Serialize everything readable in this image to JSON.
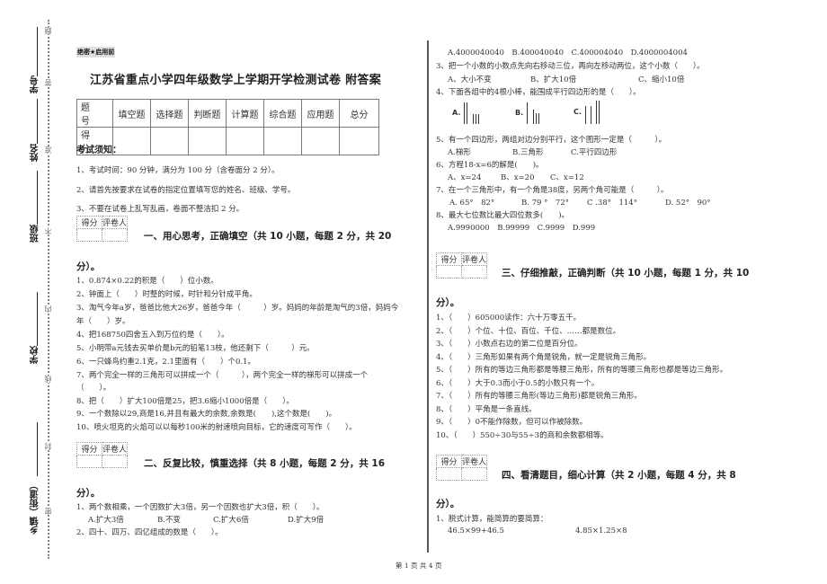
{
  "binding": {
    "fields": [
      "学号",
      "姓名",
      "班级",
      "学校",
      "乡镇（街道）"
    ],
    "seal_chars": [
      "题",
      "答",
      "准",
      "不",
      "内",
      "线",
      "封",
      "密"
    ]
  },
  "header": {
    "stamp": "绝密★启用前",
    "title": "江苏省重点小学四年级数学上学期开学检测试卷 附答案"
  },
  "score_table": {
    "header_row": [
      "题 号",
      "填空题",
      "选择题",
      "判断题",
      "计算题",
      "综合题",
      "应用题",
      "总分"
    ],
    "score_row_label": "得 分"
  },
  "notice": {
    "heading": "考试须知：",
    "items": [
      "1、考试时间：90 分钟，满分为 100 分（含卷面分 2 分）。",
      "2、请首先按要求在试卷的指定位置填写您的姓名、班级、学号。",
      "3、不要在试卷上乱写乱画，卷面不整洁扣 2 分。"
    ]
  },
  "grader_labels": [
    "得分",
    "评卷人"
  ],
  "section1": {
    "heading_line1": "一、用心思考，正确填空（共 10 小题，每题 2 分，共 20",
    "heading_line2": "分）。",
    "items": [
      "1、0.874×0.22的积是（　　）位小数。",
      "2、钟面上（　　）时整的时候，时针和分针成平角。",
      "3、淘气今年a岁，爸爸比他大26岁，爸爸今年（　　　）岁。妈妈的年龄是淘气的3倍，妈妈今",
      "年（　　）岁。",
      "4、把168750四舍五入到万位约是（　　）。",
      "5、小明带a元钱去买单价是b元的铅笔13枝，他还剩下（　　　）元。",
      "6、一只蜂鸟约重2.1克，2.1里面有（　　）个0.1。",
      "7、两个完全一样的三角形可以拼成一个（　　　），两个完全一样的梯形可以拼成一个",
      "（　　）。",
      "8、把（　　）扩大100倍是25，把3.6缩小1000倍是（　　）。",
      "9、一个数除以29,商是16,并且有最大的余数,余数是(　　),这个数是(　　)。",
      "10、喷火坦克的火焰可以以每秒100米的射速喷向目标，它的速度可写作（　　）。"
    ]
  },
  "section2": {
    "heading_line1": "二、反复比较，慎重选择（共 8 小题，每题 2 分，共 16",
    "heading_line2": "分）。",
    "q1": "1、两个数相乘，一个因数扩大3倍，另一个因数也扩大3倍，积（　　）。",
    "q1_options": [
      "A.扩大3倍",
      "B.不变",
      "C.扩大6倍",
      "D.扩大9倍"
    ],
    "q2": "2、四十、四万、四亿组成的数是（　　）。",
    "q2_options": "A.4000040040　B.400040040　C.400004040　D.4000004004",
    "q3": "3、把一个小数的小数点先向右移动三位，再向左移动两位，这个小数（　　）。",
    "q3_options": [
      "A、大小不变",
      "B、扩大10倍",
      "C、缩小10倍"
    ],
    "q4": "4、下面各组中的4根小棒，能围成平行四边形的是（　　）。",
    "q4_option_labels": [
      "A.",
      "B.",
      "C."
    ],
    "q5": "5、有一个四边形，两组对边分别平行，这个图形一定是（　　　）。",
    "q5_options": [
      "A.梯形",
      "B.三角形",
      "C.平行四边形"
    ],
    "q6": "6、方程18-x=6的解是(　　)。",
    "q6_options": [
      "A、x=24",
      "B、x=20",
      "C、x=12"
    ],
    "q7": "7、在一个三角形中，有一个角是38度，另两个角可能是（　　　）。",
    "q7_options": [
      "A. 65°　82°",
      "B. 79 °　72°",
      "C .38°　114°",
      "D. 52°　90°"
    ],
    "q8": "8、最大七位数比最大四位数多(　　)。",
    "q8_options": "A.9990000　B.99999　C.9999　D.999"
  },
  "section3": {
    "heading_line1": "三、仔细推敲，正确判断（共 10 小题，每题 1 分，共 10",
    "heading_line2": "分）。",
    "items": [
      "1、（　　）605000读作：六十万零五千。",
      "2、（　　）个位、十位、百位、千位、……都是数位。",
      "3、（　　）小数点右边的第二位是百分位。",
      "4、（　　）三角形如果有两个角是锐角，就一定是锐角三角形。",
      "5、（　　）所有的等边三角形都是等腰三角形，所有的等腰三角形也都是等边三角形。",
      "6、（　　）大于0.3而小于0.5的小数只有一个。",
      "7、（　　）所有的等腰三角形(等边三角形)都是锐角三角形。",
      "8、（　　）平角是一条直线。",
      "9、（　　）0不能作除数，但可以作被除数。",
      "10、（　　）550÷30与55÷3的商和余数都相等。"
    ]
  },
  "section4": {
    "heading_line1": "四、看清题目，细心计算（共 2 小题，每题 4 分，共 8",
    "heading_line2": "分）。",
    "q1": "1、脱式计算，能简算的要简算：",
    "expressions": [
      "46.5×99+46.5",
      "4.85×1.25×8"
    ]
  },
  "footer": {
    "page_indicator": "第 1 页 共 4 页"
  }
}
